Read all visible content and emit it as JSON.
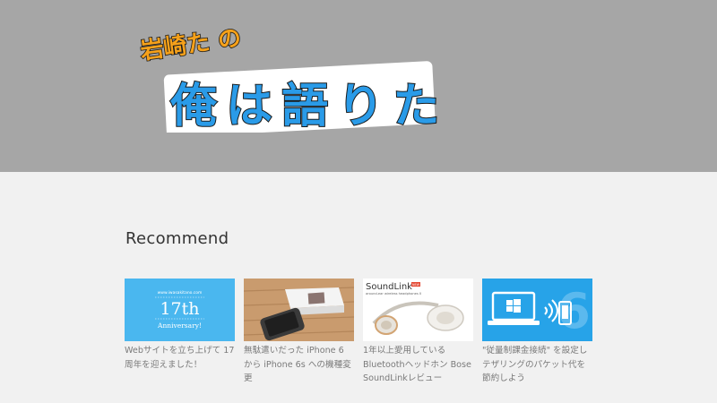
{
  "site": {
    "logo_line1": "岩崎た の",
    "logo_line2": "俺 は 語 り た い ！",
    "logo_alt": "岩崎たの俺は語りたい！"
  },
  "recommend": {
    "title": "Recommend",
    "cards": [
      {
        "caption": "Webサイトを立ち上げて 17 周年を迎えました！",
        "thumb_small_text": "www.iwasakitano.com",
        "thumb_big_text": "17th",
        "thumb_sub_text": "Anniversary!"
      },
      {
        "caption": "無駄遣いだった iPhone 6 から iPhone 6s への機種変更"
      },
      {
        "caption": "1年以上愛用している Bluetoothヘッドホン Bose SoundLinkレビュー",
        "thumb_brand": "SoundLink",
        "thumb_new": "NEW",
        "thumb_tagline": "around-ear wireless headphones II"
      },
      {
        "caption": "\"従量制課金接続\" を設定しテザリングのパケット代を節約しよう"
      }
    ]
  },
  "colors": {
    "header_bg": "#a6a6a6",
    "page_bg": "#f1f1f1",
    "logo_blue": "#2a9be8",
    "logo_orange": "#f6a11a",
    "card1_bg": "#4ab7ef",
    "card4_bg": "#27a3e8"
  }
}
